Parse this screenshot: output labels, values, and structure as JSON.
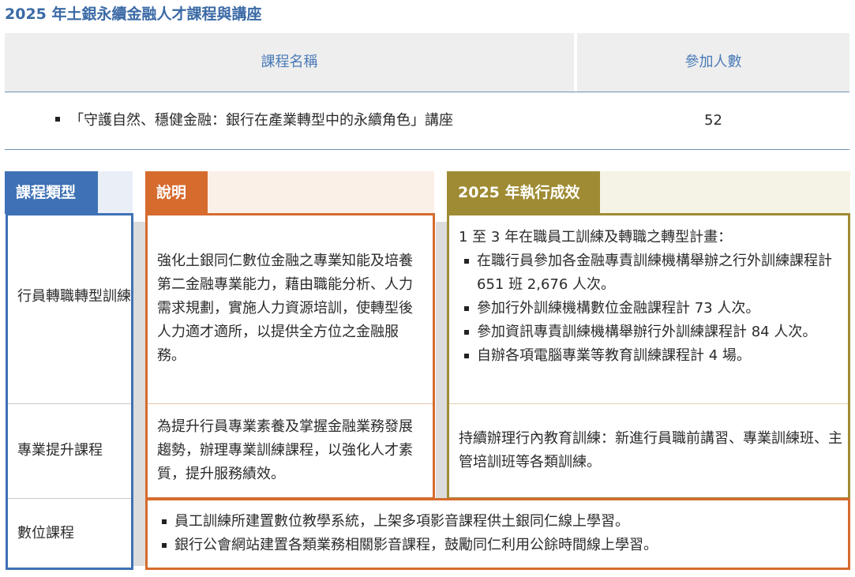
{
  "title": "2025 年土銀永續金融人才課程與講座",
  "course_table": {
    "headers": [
      "課程名稱",
      "參加人數"
    ],
    "rows": [
      {
        "name": "「守護自然、穩健金融：銀行在產業轉型中的永續角色」講座",
        "count": "52"
      }
    ]
  },
  "training_table": {
    "headers": [
      "課程類型",
      "說明",
      "2025 年執行成效"
    ],
    "rows": [
      {
        "type": "行員轉職轉型訓練",
        "description": "強化土銀同仁數位金融之專業知能及培養第二金融專業能力，藉由職能分析、人力需求規劃，實施人力資源培訓，使轉型後人力適才適所，以提供全方位之金融服務。",
        "results_intro": "1 至 3 年在職員工訓練及轉職之轉型計畫：",
        "results": [
          "在職行員參加各金融專責訓練機構舉辦之行外訓練課程計 651 班 2,676 人次。",
          "參加行外訓練機構數位金融課程計 73 人次。",
          "參加資訊專責訓練機構舉辦行外訓練課程計 84 人次。",
          "自辦各項電腦專業等教育訓練課程計 4 場。"
        ]
      },
      {
        "type": "專業提升課程",
        "description": "為提升行員專業素養及掌握金融業務發展趨勢，辦理專業訓練課程，以強化人才素質，提升服務績效。",
        "results_text": "持續辦理行內教育訓練：新進行員職前講習、專業訓練班、主管培訓班等各類訓練。"
      },
      {
        "type": "數位課程",
        "items": [
          "員工訓練所建置數位教學系統，上架多項影音課程供土銀同仁線上學習。",
          "銀行公會網站建置各類業務相關影音課程，鼓勵同仁利用公餘時間線上學習。"
        ]
      }
    ]
  },
  "colors": {
    "title": "#3b6aa6",
    "blue": "#3e71b5",
    "orange": "#d66b2e",
    "olive": "#9f8b33",
    "header_bg": "#eeeeee"
  }
}
